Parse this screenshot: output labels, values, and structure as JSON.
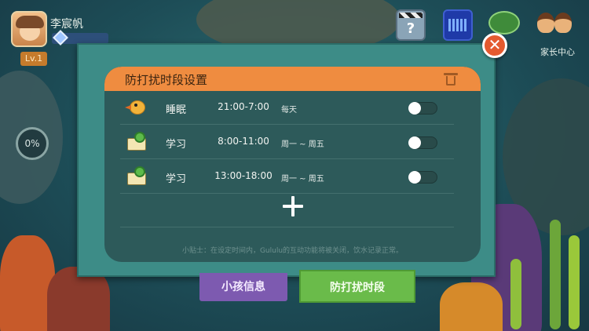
{
  "profile": {
    "name": "李宸帆",
    "level": "Lv.1",
    "progress": "0%"
  },
  "top_icons": {
    "clapper": "?",
    "parents_label": "家长中心"
  },
  "modal": {
    "title": "防打扰时段设置",
    "close_glyph": "✕",
    "rows": [
      {
        "icon": "bird-icon",
        "name": "睡眠",
        "time": "21:00-7:00",
        "days": "每天",
        "enabled": false
      },
      {
        "icon": "book-clock-icon",
        "name": "学习",
        "time": "8:00-11:00",
        "days": "周一 ~ 周五",
        "enabled": false
      },
      {
        "icon": "book-clock-icon",
        "name": "学习",
        "time": "13:00-18:00",
        "days": "周一 ~ 周五",
        "enabled": false
      }
    ],
    "tip": "小贴士：在设定时间内，Gululu的互动功能将被关闭，饮水记录正常。"
  },
  "tabs": {
    "child_info": "小孩信息",
    "do_not_disturb": "防打扰时段"
  },
  "colors": {
    "header_orange": "#ef8c40",
    "panel_teal": "#2d5a5a",
    "frame_teal": "#3d8c87",
    "tab_purple": "#7d5ab0",
    "tab_green": "#6abb4a",
    "close_red": "#e45a2f"
  }
}
